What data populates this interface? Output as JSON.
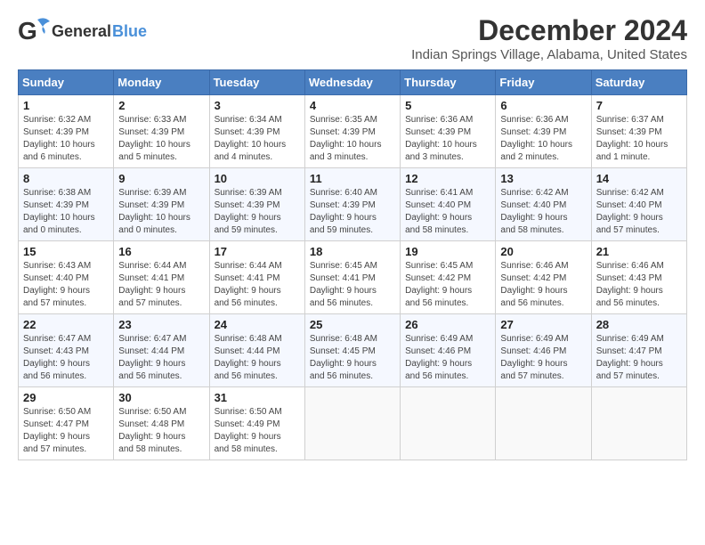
{
  "logo": {
    "text_general": "General",
    "text_blue": "Blue"
  },
  "title": "December 2024",
  "subtitle": "Indian Springs Village, Alabama, United States",
  "days_of_week": [
    "Sunday",
    "Monday",
    "Tuesday",
    "Wednesday",
    "Thursday",
    "Friday",
    "Saturday"
  ],
  "weeks": [
    [
      {
        "day": "1",
        "info": "Sunrise: 6:32 AM\nSunset: 4:39 PM\nDaylight: 10 hours\nand 6 minutes."
      },
      {
        "day": "2",
        "info": "Sunrise: 6:33 AM\nSunset: 4:39 PM\nDaylight: 10 hours\nand 5 minutes."
      },
      {
        "day": "3",
        "info": "Sunrise: 6:34 AM\nSunset: 4:39 PM\nDaylight: 10 hours\nand 4 minutes."
      },
      {
        "day": "4",
        "info": "Sunrise: 6:35 AM\nSunset: 4:39 PM\nDaylight: 10 hours\nand 3 minutes."
      },
      {
        "day": "5",
        "info": "Sunrise: 6:36 AM\nSunset: 4:39 PM\nDaylight: 10 hours\nand 3 minutes."
      },
      {
        "day": "6",
        "info": "Sunrise: 6:36 AM\nSunset: 4:39 PM\nDaylight: 10 hours\nand 2 minutes."
      },
      {
        "day": "7",
        "info": "Sunrise: 6:37 AM\nSunset: 4:39 PM\nDaylight: 10 hours\nand 1 minute."
      }
    ],
    [
      {
        "day": "8",
        "info": "Sunrise: 6:38 AM\nSunset: 4:39 PM\nDaylight: 10 hours\nand 0 minutes."
      },
      {
        "day": "9",
        "info": "Sunrise: 6:39 AM\nSunset: 4:39 PM\nDaylight: 10 hours\nand 0 minutes."
      },
      {
        "day": "10",
        "info": "Sunrise: 6:39 AM\nSunset: 4:39 PM\nDaylight: 9 hours\nand 59 minutes."
      },
      {
        "day": "11",
        "info": "Sunrise: 6:40 AM\nSunset: 4:39 PM\nDaylight: 9 hours\nand 59 minutes."
      },
      {
        "day": "12",
        "info": "Sunrise: 6:41 AM\nSunset: 4:40 PM\nDaylight: 9 hours\nand 58 minutes."
      },
      {
        "day": "13",
        "info": "Sunrise: 6:42 AM\nSunset: 4:40 PM\nDaylight: 9 hours\nand 58 minutes."
      },
      {
        "day": "14",
        "info": "Sunrise: 6:42 AM\nSunset: 4:40 PM\nDaylight: 9 hours\nand 57 minutes."
      }
    ],
    [
      {
        "day": "15",
        "info": "Sunrise: 6:43 AM\nSunset: 4:40 PM\nDaylight: 9 hours\nand 57 minutes."
      },
      {
        "day": "16",
        "info": "Sunrise: 6:44 AM\nSunset: 4:41 PM\nDaylight: 9 hours\nand 57 minutes."
      },
      {
        "day": "17",
        "info": "Sunrise: 6:44 AM\nSunset: 4:41 PM\nDaylight: 9 hours\nand 56 minutes."
      },
      {
        "day": "18",
        "info": "Sunrise: 6:45 AM\nSunset: 4:41 PM\nDaylight: 9 hours\nand 56 minutes."
      },
      {
        "day": "19",
        "info": "Sunrise: 6:45 AM\nSunset: 4:42 PM\nDaylight: 9 hours\nand 56 minutes."
      },
      {
        "day": "20",
        "info": "Sunrise: 6:46 AM\nSunset: 4:42 PM\nDaylight: 9 hours\nand 56 minutes."
      },
      {
        "day": "21",
        "info": "Sunrise: 6:46 AM\nSunset: 4:43 PM\nDaylight: 9 hours\nand 56 minutes."
      }
    ],
    [
      {
        "day": "22",
        "info": "Sunrise: 6:47 AM\nSunset: 4:43 PM\nDaylight: 9 hours\nand 56 minutes."
      },
      {
        "day": "23",
        "info": "Sunrise: 6:47 AM\nSunset: 4:44 PM\nDaylight: 9 hours\nand 56 minutes."
      },
      {
        "day": "24",
        "info": "Sunrise: 6:48 AM\nSunset: 4:44 PM\nDaylight: 9 hours\nand 56 minutes."
      },
      {
        "day": "25",
        "info": "Sunrise: 6:48 AM\nSunset: 4:45 PM\nDaylight: 9 hours\nand 56 minutes."
      },
      {
        "day": "26",
        "info": "Sunrise: 6:49 AM\nSunset: 4:46 PM\nDaylight: 9 hours\nand 56 minutes."
      },
      {
        "day": "27",
        "info": "Sunrise: 6:49 AM\nSunset: 4:46 PM\nDaylight: 9 hours\nand 57 minutes."
      },
      {
        "day": "28",
        "info": "Sunrise: 6:49 AM\nSunset: 4:47 PM\nDaylight: 9 hours\nand 57 minutes."
      }
    ],
    [
      {
        "day": "29",
        "info": "Sunrise: 6:50 AM\nSunset: 4:47 PM\nDaylight: 9 hours\nand 57 minutes."
      },
      {
        "day": "30",
        "info": "Sunrise: 6:50 AM\nSunset: 4:48 PM\nDaylight: 9 hours\nand 58 minutes."
      },
      {
        "day": "31",
        "info": "Sunrise: 6:50 AM\nSunset: 4:49 PM\nDaylight: 9 hours\nand 58 minutes."
      },
      {
        "day": "",
        "info": ""
      },
      {
        "day": "",
        "info": ""
      },
      {
        "day": "",
        "info": ""
      },
      {
        "day": "",
        "info": ""
      }
    ]
  ]
}
